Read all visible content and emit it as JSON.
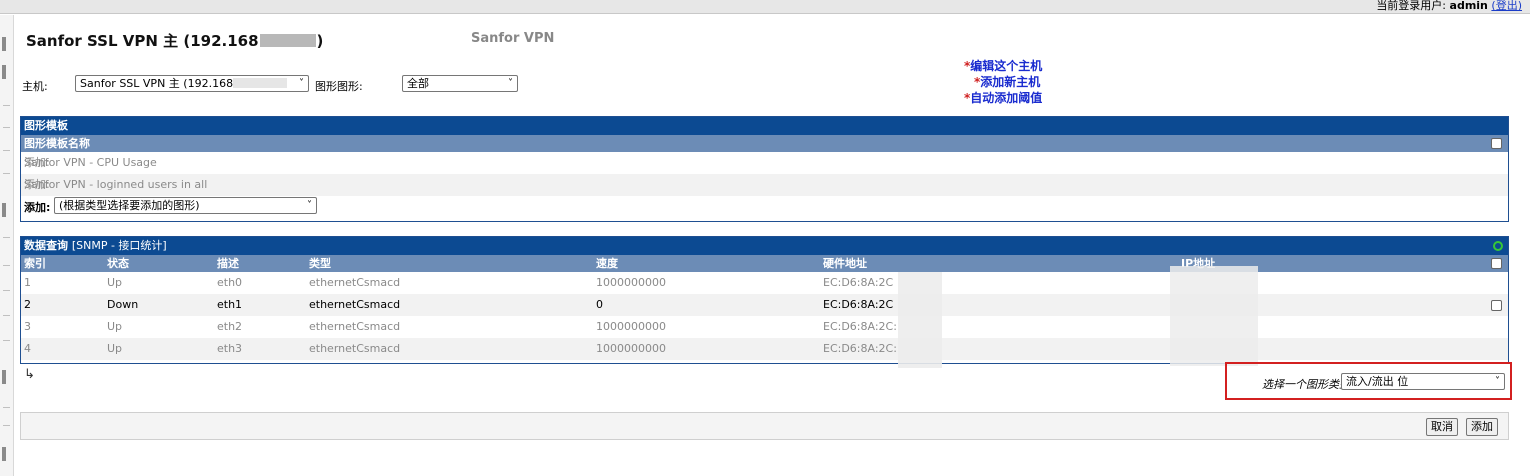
{
  "header": {
    "login_label": "当前登录用户:",
    "user": "admin",
    "logout": "(登出)"
  },
  "page": {
    "title_prefix": "Sanfor SSL VPN 主 (192.168",
    "title_suffix": ")",
    "subtitle": "Sanfor VPN"
  },
  "filters": {
    "host_label": "主机:",
    "host_value": "Sanfor SSL VPN 主 (192.168",
    "graph_label": "图形图形:",
    "graph_value": "全部"
  },
  "actions": [
    {
      "star": "*",
      "text": "编辑这个主机"
    },
    {
      "star": "*",
      "text": "添加新主机"
    },
    {
      "star": "*",
      "text": "自动添加阈值"
    }
  ],
  "templates": {
    "panel_title": "图形模板",
    "column_header": "图形模板名称",
    "rows": [
      {
        "prefix": "添加:",
        "name": "Sanfor VPN - CPU Usage"
      },
      {
        "prefix": "添加:",
        "name": "Sanfor VPN - loginned users in all"
      }
    ],
    "add_label": "添加:",
    "add_select": "(根据类型选择要添加的图形)"
  },
  "query": {
    "panel_title": "数据查询",
    "panel_subtitle": "[SNMP - 接口统计]",
    "columns": [
      "索引",
      "状态",
      "描述",
      "类型",
      "速度",
      "硬件地址",
      "IP地址"
    ],
    "rows": [
      {
        "index": "1",
        "status": "Up",
        "desc": "eth0",
        "type": "ethernetCsmacd",
        "speed": "1000000000",
        "mac": "EC:D6:8A:2C"
      },
      {
        "index": "2",
        "status": "Down",
        "desc": "eth1",
        "type": "ethernetCsmacd",
        "speed": "0",
        "mac": "EC:D6:8A:2C"
      },
      {
        "index": "3",
        "status": "Up",
        "desc": "eth2",
        "type": "ethernetCsmacd",
        "speed": "1000000000",
        "mac": "EC:D6:8A:2C:"
      },
      {
        "index": "4",
        "status": "Up",
        "desc": "eth3",
        "type": "ethernetCsmacd",
        "speed": "1000000000",
        "mac": "EC:D6:8A:2C:"
      }
    ],
    "graph_type_label": "选择一个图形类型:",
    "graph_type_value": "流入/流出 位"
  },
  "buttons": {
    "cancel": "取消",
    "add": "添加"
  }
}
